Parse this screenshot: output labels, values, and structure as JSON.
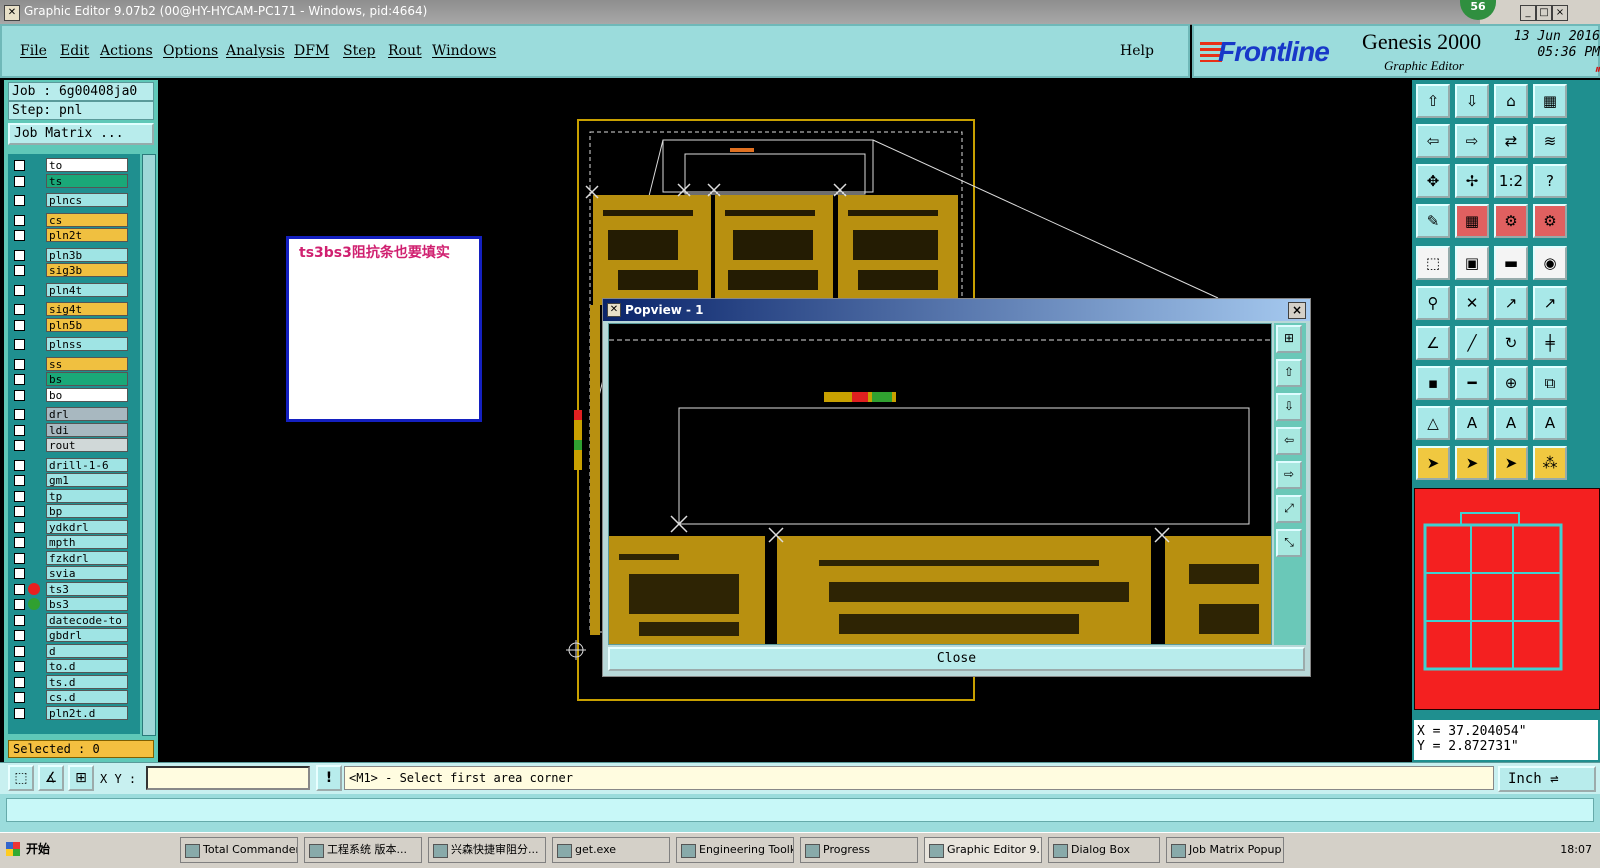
{
  "window": {
    "title": "Graphic Editor 9.07b2 (00@HY-HYCAM-PC171 - Windows, pid:4664)",
    "badge": "56",
    "controls": [
      "_",
      "□",
      "×"
    ]
  },
  "menubar": {
    "items": [
      "File",
      "Edit",
      "Actions",
      "Options",
      "Analysis",
      "DFM",
      "Step",
      "Rout",
      "Windows"
    ],
    "help": "Help"
  },
  "logo": {
    "brand": "Frontline",
    "product": "Genesis 2000",
    "subtitle": "Graphic Editor",
    "date": "13 Jun 2016",
    "time": "05:36 PM",
    "pause_glyph": "⏸"
  },
  "left": {
    "job": "Job : 6g00408ja0",
    "step": "Step: pnl",
    "job_matrix": "Job Matrix ...",
    "selected": "Selected : 0",
    "layers": [
      {
        "name": "to",
        "color": "#ffffff"
      },
      {
        "name": "ts",
        "color": "#1aa878"
      },
      {
        "name": "plncs",
        "color": "#9fe4e4"
      },
      {
        "name": "cs",
        "color": "#f0c040"
      },
      {
        "name": "pln2t",
        "color": "#f0c040"
      },
      {
        "name": "pln3b",
        "color": "#9fe4e4"
      },
      {
        "name": "sig3b",
        "color": "#f0c040"
      },
      {
        "name": "pln4t",
        "color": "#9fe4e4"
      },
      {
        "name": "sig4t",
        "color": "#f0c040"
      },
      {
        "name": "pln5b",
        "color": "#f0c040"
      },
      {
        "name": "plnss",
        "color": "#9fe4e4"
      },
      {
        "name": "ss",
        "color": "#f0c040"
      },
      {
        "name": "bs",
        "color": "#1aa878"
      },
      {
        "name": "bo",
        "color": "#ffffff"
      },
      {
        "name": "drl",
        "color": "#a8b8c0"
      },
      {
        "name": "ldi",
        "color": "#a8b8c0"
      },
      {
        "name": "rout",
        "color": "#d0d8d8"
      },
      {
        "name": "drill-1-6",
        "color": "#9fe4e4"
      },
      {
        "name": "gm1",
        "color": "#9fe4e4"
      },
      {
        "name": "tp",
        "color": "#9fe4e4"
      },
      {
        "name": "bp",
        "color": "#9fe4e4"
      },
      {
        "name": "ydkdrl",
        "color": "#9fe4e4"
      },
      {
        "name": "mpth",
        "color": "#9fe4e4"
      },
      {
        "name": "fzkdrl",
        "color": "#9fe4e4"
      },
      {
        "name": "svia",
        "color": "#9fe4e4"
      },
      {
        "name": "ts3",
        "color": "#9fe4e4",
        "dot": "#e82020"
      },
      {
        "name": "bs3",
        "color": "#9fe4e4",
        "dot": "#30a030"
      },
      {
        "name": "datecode-to",
        "color": "#9fe4e4"
      },
      {
        "name": "gbdrl",
        "color": "#9fe4e4"
      },
      {
        "name": "d",
        "color": "#9fe4e4"
      },
      {
        "name": "to.d",
        "color": "#9fe4e4"
      },
      {
        "name": "ts.d",
        "color": "#9fe4e4"
      },
      {
        "name": "cs.d",
        "color": "#9fe4e4"
      },
      {
        "name": "pln2t.d",
        "color": "#9fe4e4"
      }
    ]
  },
  "canvas": {
    "note": "ts3bs3阻抗条也要填实"
  },
  "popview": {
    "title": "Popview - 1",
    "close_label": "Close",
    "close_glyph": "×",
    "tools": [
      "⊞",
      "⇧",
      "⇩",
      "⇦",
      "⇨",
      "⤢",
      "⤡"
    ]
  },
  "toolbox": {
    "tools": [
      "⇧",
      "⇩",
      "⌂",
      "▦",
      "⇦",
      "⇨",
      "⇄",
      "≋",
      "✥",
      "✢",
      "1:2",
      "?",
      "✎",
      "▦",
      "⚙",
      "⚙",
      "⬚",
      "▣",
      "▬",
      "◉",
      "⚲",
      "✕",
      "↗",
      "↗",
      "∠",
      "╱",
      "↻",
      "╪",
      "▪",
      "━",
      "⊕",
      "⧉",
      "△",
      "A",
      "A",
      "A",
      "➤",
      "➤",
      "➤",
      "⁂"
    ],
    "coord_x": "X = 37.204054\"",
    "coord_y": "Y = 2.872731\""
  },
  "cmdbar": {
    "xy_label": "X Y :",
    "xy_value": "",
    "alert_glyph": "!",
    "prompt": "<M1> - Select first area corner",
    "units": "Inch  ⇌",
    "tool_glyphs": [
      "⬚",
      "∡",
      "⊞"
    ]
  },
  "taskbar": {
    "start": "开始",
    "items": [
      "Total Commander...",
      "工程系统 版本...",
      "兴森快捷审阻分...",
      "get.exe",
      "Engineering Toolk...",
      "Progress",
      "Graphic Editor 9....",
      "Dialog Box",
      "Job Matrix Popup"
    ],
    "clock": "18:07"
  }
}
